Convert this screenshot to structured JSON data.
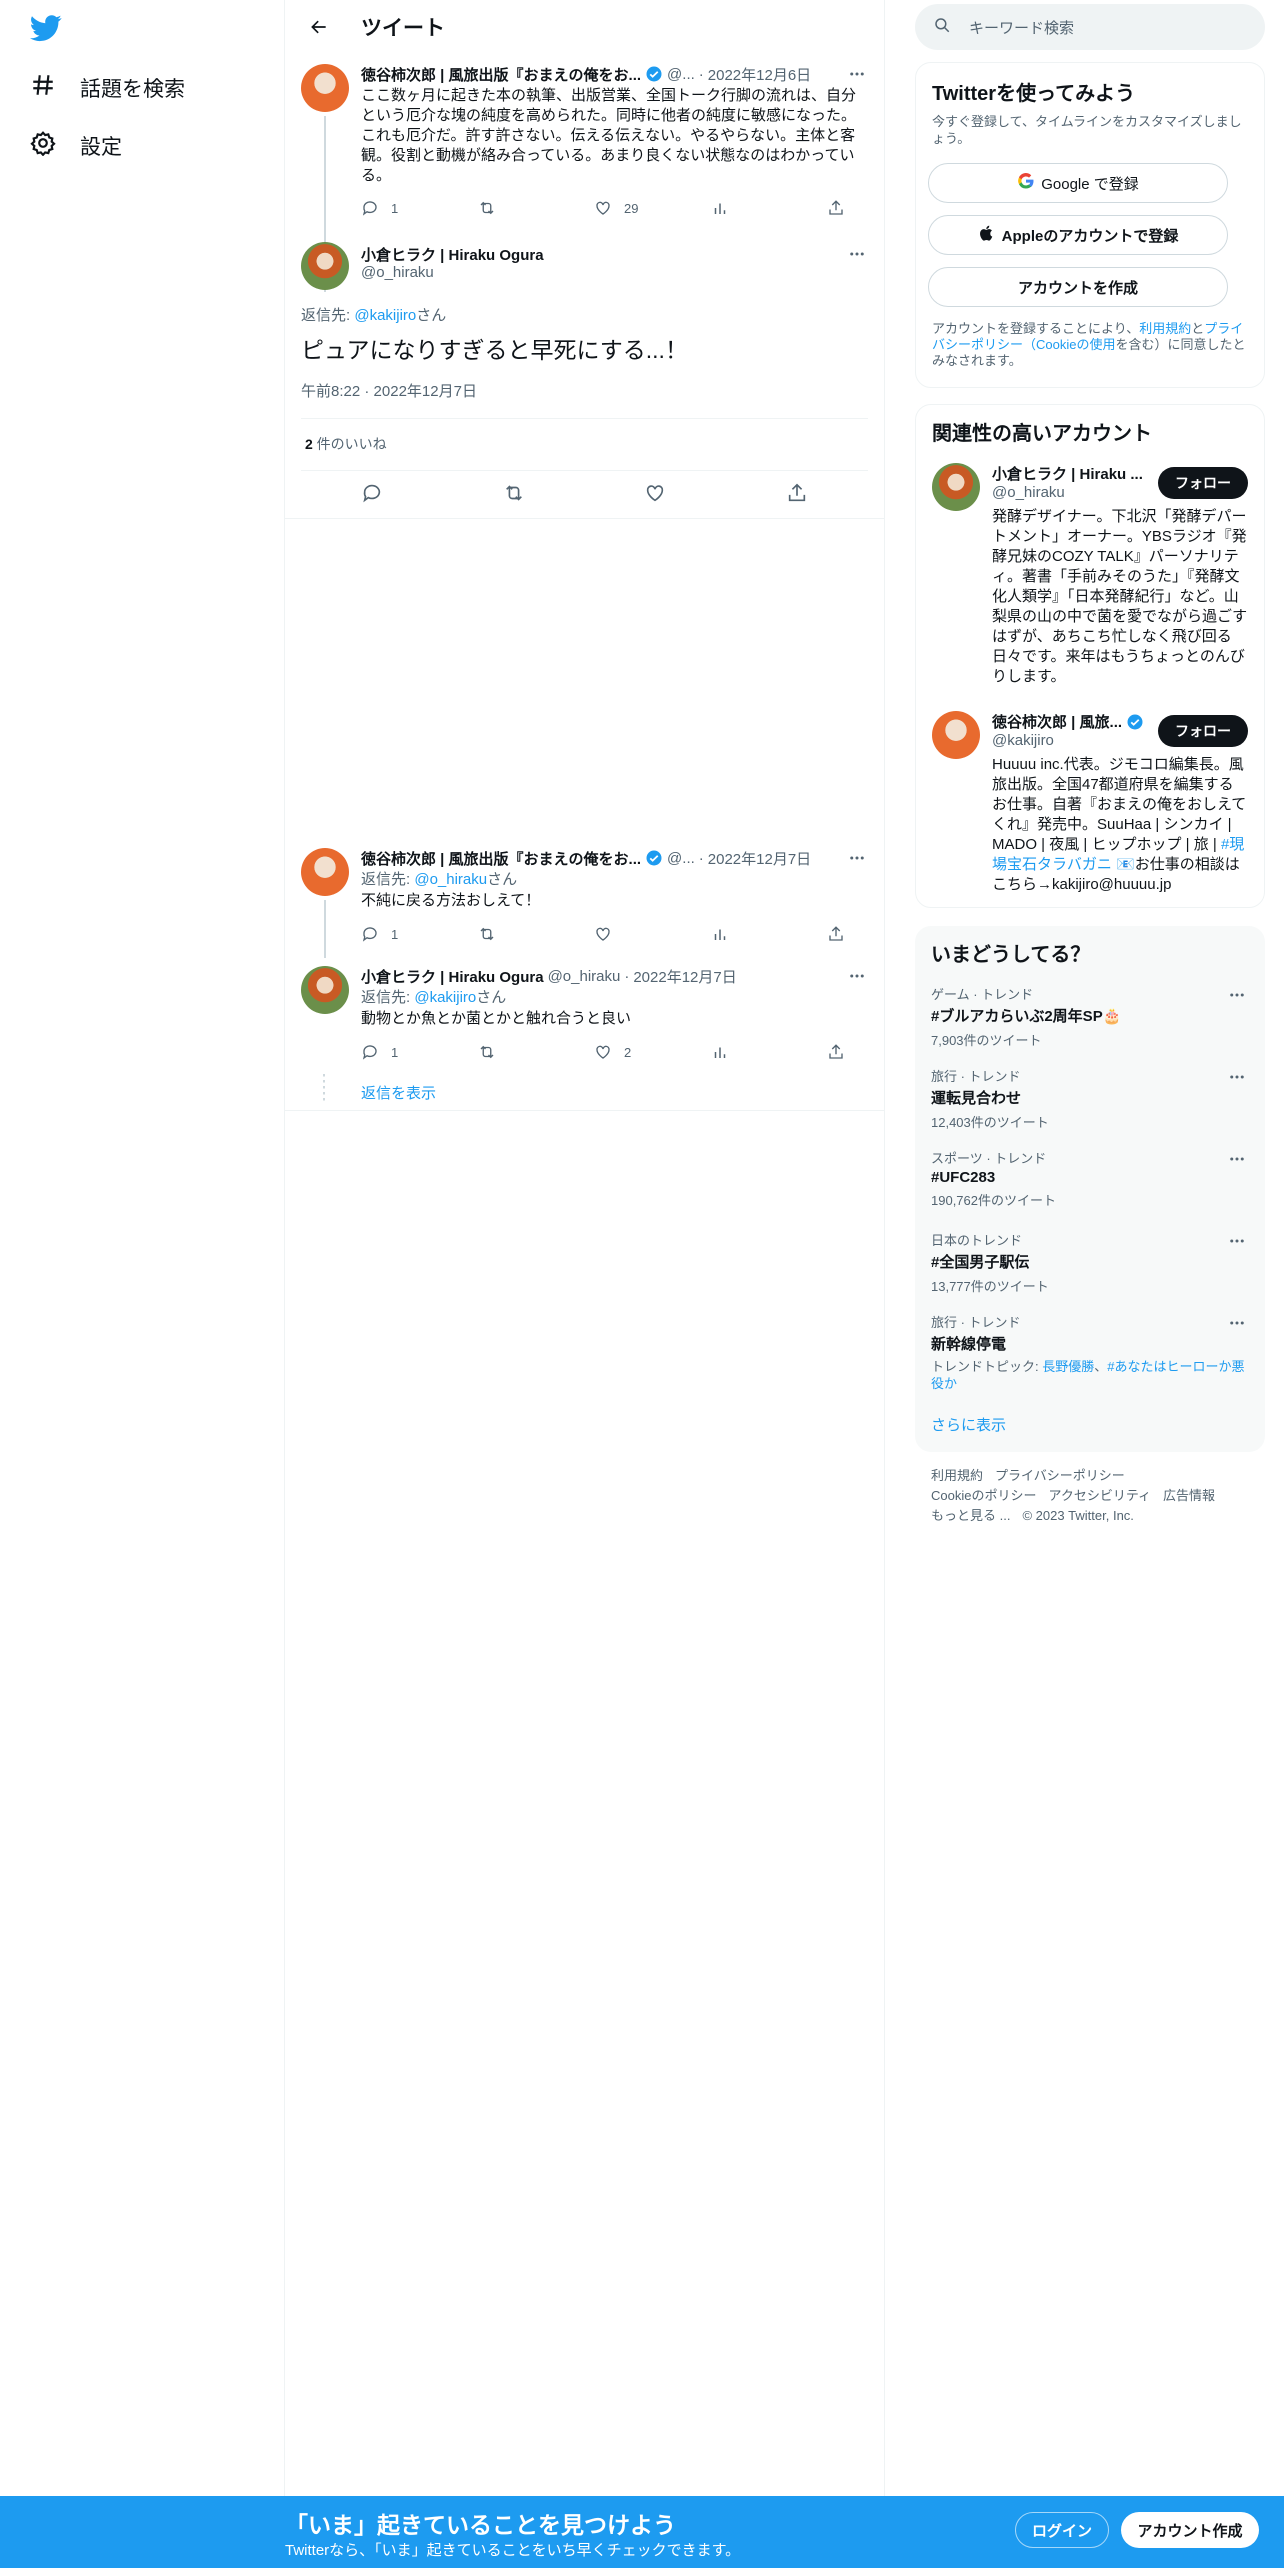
{
  "nav": {
    "explore_label": "話題を検索",
    "settings_label": "設定"
  },
  "header": {
    "title": "ツイート"
  },
  "tweet1": {
    "name": "徳谷柿次郎 | 風旅出版『おまえの俺をお...",
    "handle": "@...",
    "date": "2022年12月6日",
    "text": "ここ数ヶ月に起きた本の執筆、出版営業、全国トーク行脚の流れは、自分という厄介な塊の純度を高められた。同時に他者の純度に敏感になった。これも厄介だ。許す許さない。伝える伝えない。やるやらない。主体と客観。役割と動機が絡み合っている。あまり良くない状態なのはわかっている。",
    "replies": "1",
    "likes": "29"
  },
  "main_tweet": {
    "name": "小倉ヒラク | Hiraku Ogura",
    "handle": "@o_hiraku",
    "reply_prefix": "返信先: ",
    "reply_handle": "@kakijiro",
    "reply_suffix": "さん",
    "text": "ピュアになりすぎると早死にする...！",
    "time": "午前8:22",
    "date": "2022年12月7日",
    "likes_count": "2",
    "likes_label": " 件のいいね"
  },
  "reply1": {
    "name": "徳谷柿次郎 | 風旅出版『おまえの俺をお...",
    "handle": "@...",
    "date": "2022年12月7日",
    "reply_prefix": "返信先: ",
    "reply_handle": "@o_hiraku",
    "reply_suffix": "さん",
    "text": "不純に戻る方法おしえて！",
    "replies": "1"
  },
  "reply2": {
    "name": "小倉ヒラク | Hiraku Ogura",
    "handle": "@o_hiraku",
    "date": "2022年12月7日",
    "reply_prefix": "返信先: ",
    "reply_handle": "@kakijiro",
    "reply_suffix": "さん",
    "text": "動物とか魚とか菌とかと触れ合うと良い",
    "replies": "1",
    "likes": "2"
  },
  "show_replies": "返信を表示",
  "search": {
    "placeholder": "キーワード検索"
  },
  "signup": {
    "title": "Twitterを使ってみよう",
    "subtitle": "今すぐ登録して、タイムラインをカスタマイズしましょう。",
    "google_label": "Google で登録",
    "apple_label": "Appleのアカウントで登録",
    "create_label": "アカウントを作成",
    "terms_prefix": "アカウントを登録することにより、",
    "terms_link1": "利用規約",
    "terms_and": "と",
    "terms_link2": "プライバシーポリシー（Cookieの使用",
    "terms_suffix": "を含む）に同意したとみなされます。"
  },
  "related": {
    "title": "関連性の高いアカウント",
    "accounts": [
      {
        "name": "小倉ヒラク | Hiraku ...",
        "handle": "@o_hiraku",
        "follow": "フォロー",
        "bio": "発酵デザイナー。下北沢「発酵デパートメント」オーナー。YBSラジオ『発酵兄妹のCOZY TALK』パーソナリティ。著書「手前みそのうた」『発酵文化人類学』「日本発酵紀行」など。山梨県の山の中で菌を愛でながら過ごすはずが、あちこち忙しなく飛び回る日々です。来年はもうちょっとのんびりします。"
      },
      {
        "name": "徳谷柿次郎 | 風旅...",
        "handle": "@kakijiro",
        "follow": "フォロー",
        "bio_pre": "Huuuu inc.代表。ジモコロ編集長。風旅出版。全国47都道府県を編集するお仕事。自著『おまえの俺をおしえてくれ』発売中。SuuHaa | シンカイ | MADO | 夜風 | ヒップホップ | 旅 | ",
        "bio_link": "#現場宝石タラバガニ",
        "bio_post": " 📧お仕事の相談はこちら→kakijiro@huuuu.jp"
      }
    ]
  },
  "trends": {
    "title": "いまどうしてる？",
    "items": [
      {
        "category": "ゲーム · トレンド",
        "name": "#ブルアカらいぶ2周年SP🎂",
        "count": "7,903件のツイート"
      },
      {
        "category": "旅行 · トレンド",
        "name": "運転見合わせ",
        "count": "12,403件のツイート"
      },
      {
        "category": "スポーツ · トレンド",
        "name": "#UFC283",
        "count": "190,762件のツイート"
      },
      {
        "category": "日本のトレンド",
        "name": "#全国男子駅伝",
        "count": "13,777件のツイート"
      },
      {
        "category": "旅行 · トレンド",
        "name": "新幹線停電",
        "topics_label": "トレンドトピック: ",
        "topic1": "長野優勝",
        "topic_sep": "、",
        "topic2": "#あなたはヒーローか悪役か"
      }
    ],
    "show_more": "さらに表示"
  },
  "footer": {
    "terms": "利用規約",
    "privacy": "プライバシーポリシー",
    "cookie": "Cookieのポリシー",
    "accessibility": "アクセシビリティ",
    "ads": "広告情報",
    "more": "もっと見る ...",
    "copyright": "© 2023 Twitter, Inc."
  },
  "bottom_bar": {
    "title": "「いま」起きていることを見つけよう",
    "subtitle": "Twitterなら、「いま」起きていることをいち早くチェックできます。",
    "login": "ログイン",
    "signup": "アカウント作成"
  },
  "colors": {
    "accent": "#1d9bf0",
    "text": "#0f1419",
    "muted": "#536471"
  }
}
